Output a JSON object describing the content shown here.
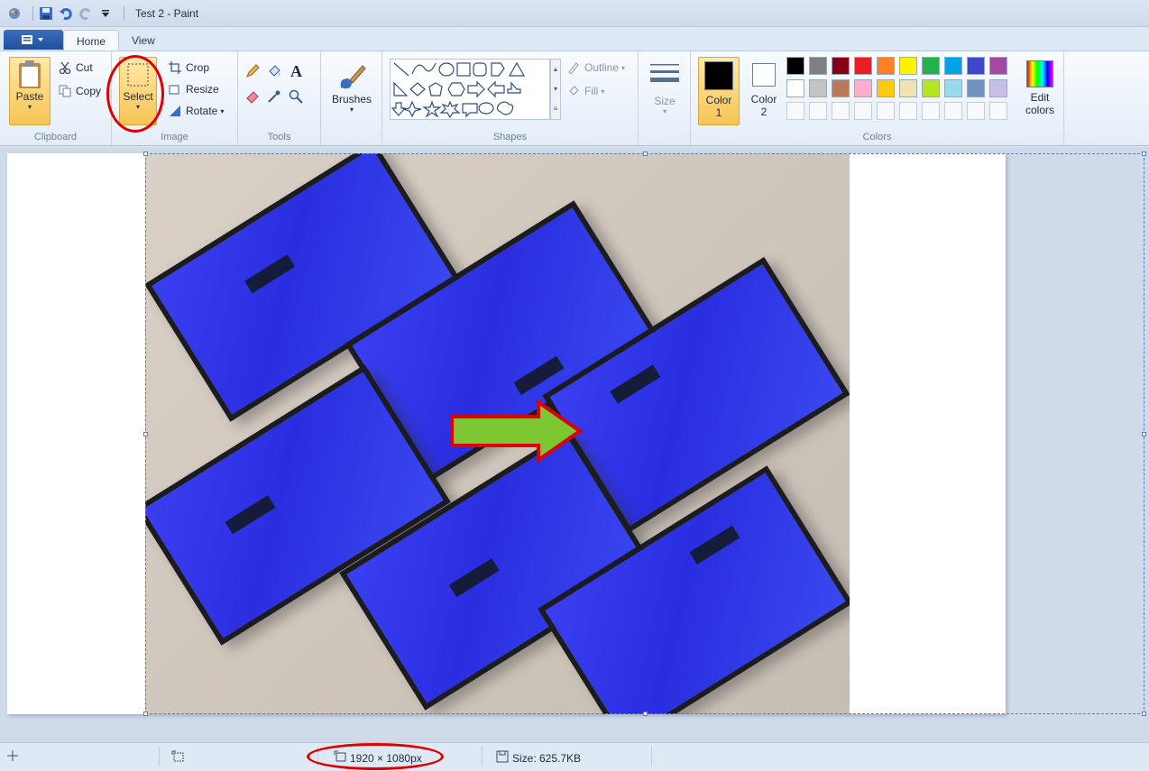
{
  "window": {
    "title": "Test 2 - Paint"
  },
  "tabs": [
    {
      "label": "Home",
      "active": true
    },
    {
      "label": "View",
      "active": false
    }
  ],
  "clipboard": {
    "paste": "Paste",
    "cut": "Cut",
    "copy": "Copy",
    "group": "Clipboard"
  },
  "image": {
    "select": "Select",
    "crop": "Crop",
    "resize": "Resize",
    "rotate": "Rotate",
    "group": "Image"
  },
  "tools": {
    "group": "Tools"
  },
  "brushes": {
    "label": "Brushes"
  },
  "shapes": {
    "outline": "Outline",
    "fill": "Fill",
    "group": "Shapes"
  },
  "size": {
    "label": "Size"
  },
  "colors": {
    "color1": "Color 1",
    "color1_a": "Color",
    "color1_b": "1",
    "color2_a": "Color",
    "color2_b": "2",
    "edit_a": "Edit",
    "edit_b": "colors",
    "group": "Colors",
    "palette_row1": [
      "#000000",
      "#7f7f7f",
      "#880015",
      "#ed1c24",
      "#ff7f27",
      "#fff200",
      "#22b14c",
      "#00a2e8",
      "#3f48cc",
      "#a349a4"
    ],
    "palette_row2": [
      "#ffffff",
      "#c3c3c3",
      "#b97a57",
      "#ffaec9",
      "#ffc90e",
      "#efe4b0",
      "#b5e61d",
      "#99d9ea",
      "#7092be",
      "#c8bfe7"
    ]
  },
  "status": {
    "dimensions": "1920 × 1080px",
    "size": "Size: 625.7KB"
  },
  "annotation": {
    "color": "#e00000",
    "arrow_fill": "#7dc832",
    "arrow_border": "#e00000"
  }
}
